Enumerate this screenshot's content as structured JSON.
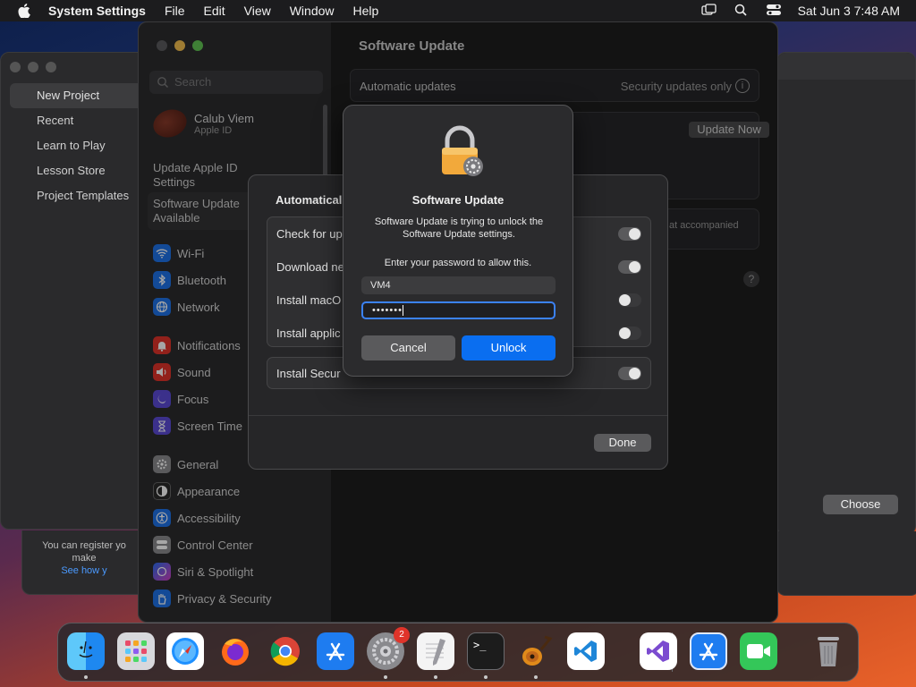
{
  "menubar": {
    "app_name": "System Settings",
    "menus": [
      "File",
      "Edit",
      "View",
      "Window",
      "Help"
    ],
    "clock": "Sat Jun 3  7:48 AM"
  },
  "bg_window": {
    "nav": [
      "New Project",
      "Recent",
      "Learn to Play",
      "Lesson Store",
      "Project Templates"
    ],
    "note_line1": "You can register yo",
    "note_line2": "make",
    "note_link": "See how y",
    "choose_label": "Choose"
  },
  "sidebar": {
    "search_placeholder": "Search",
    "profile_name": "Calub Viem",
    "profile_sub": "Apple ID",
    "update_apple_id_1": "Update Apple ID",
    "update_apple_id_2": "Settings",
    "software_update_1": "Software Update",
    "software_update_2": "Available",
    "items": [
      {
        "label": "Wi-Fi",
        "icon": "wifi-icon",
        "color": "#1e72e8"
      },
      {
        "label": "Bluetooth",
        "icon": "bluetooth-icon",
        "color": "#1e72e8"
      },
      {
        "label": "Network",
        "icon": "globe-icon",
        "color": "#1e72e8"
      },
      {
        "label": "Notifications",
        "icon": "bell-icon",
        "color": "#e0342a"
      },
      {
        "label": "Sound",
        "icon": "speaker-icon",
        "color": "#e0342a"
      },
      {
        "label": "Focus",
        "icon": "moon-icon",
        "color": "#5b4bd6"
      },
      {
        "label": "Screen Time",
        "icon": "hourglass-icon",
        "color": "#5b4bd6"
      },
      {
        "label": "General",
        "icon": "gear-icon",
        "color": "#8a8a8e"
      },
      {
        "label": "Appearance",
        "icon": "appearance-icon",
        "color": "#2a2a2a"
      },
      {
        "label": "Accessibility",
        "icon": "accessibility-icon",
        "color": "#1e72e8"
      },
      {
        "label": "Control Center",
        "icon": "control-center-icon",
        "color": "#8a8a8e"
      },
      {
        "label": "Siri & Spotlight",
        "icon": "siri-icon",
        "color": "#c040c0"
      },
      {
        "label": "Privacy & Security",
        "icon": "hand-icon",
        "color": "#1e72e8"
      }
    ]
  },
  "main": {
    "title": "Software Update",
    "automatic_updates_label": "Automatic updates",
    "automatic_updates_value": "Security updates only",
    "update_now": "Update Now",
    "accompanied_text": "at accompanied"
  },
  "sheet": {
    "title": "Automatical",
    "rows": [
      {
        "label": "Check for up",
        "on": true
      },
      {
        "label": "Download ne",
        "on": true
      },
      {
        "label": "Install macO",
        "on": false
      },
      {
        "label": "Install applic",
        "on": false
      }
    ],
    "security_row": {
      "label": "Install Secur",
      "on": true
    },
    "done": "Done"
  },
  "dialog": {
    "title": "Software Update",
    "message": "Software Update is trying to unlock the Software Update settings.",
    "prompt": "Enter your password to allow this.",
    "username": "VM4",
    "password_mask": "•••••••",
    "cancel": "Cancel",
    "unlock": "Unlock"
  },
  "dock": {
    "apps": [
      {
        "name": "finder-icon",
        "color": "#1e88f0",
        "running": true
      },
      {
        "name": "launchpad-icon",
        "color": "#d8d8dc",
        "running": false
      },
      {
        "name": "safari-icon",
        "color": "#1e90ff",
        "running": false
      },
      {
        "name": "firefox-icon",
        "color": "#ff6a1a",
        "running": false
      },
      {
        "name": "chrome-icon",
        "color": "#ffffff",
        "running": false
      },
      {
        "name": "app-store-icon",
        "color": "#1e7cf0",
        "running": false
      },
      {
        "name": "system-settings-icon",
        "color": "#8a8a8e",
        "running": true,
        "badge": "2"
      },
      {
        "name": "textedit-icon",
        "color": "#f4f4f4",
        "running": true
      },
      {
        "name": "terminal-icon",
        "color": "#1c1c1c",
        "running": true
      },
      {
        "name": "garageband-icon",
        "color": "#e08a1a",
        "running": true
      },
      {
        "name": "vscode-icon",
        "color": "#ffffff",
        "running": false
      },
      {
        "name": "visual-studio-icon",
        "color": "#ffffff",
        "running": false
      },
      {
        "name": "xcode-installer-icon",
        "color": "#1e7cf0",
        "running": false
      },
      {
        "name": "facetime-icon",
        "color": "#34c759",
        "running": false
      },
      {
        "name": "trash-icon",
        "color": "#9a9a9e",
        "running": false
      }
    ]
  }
}
